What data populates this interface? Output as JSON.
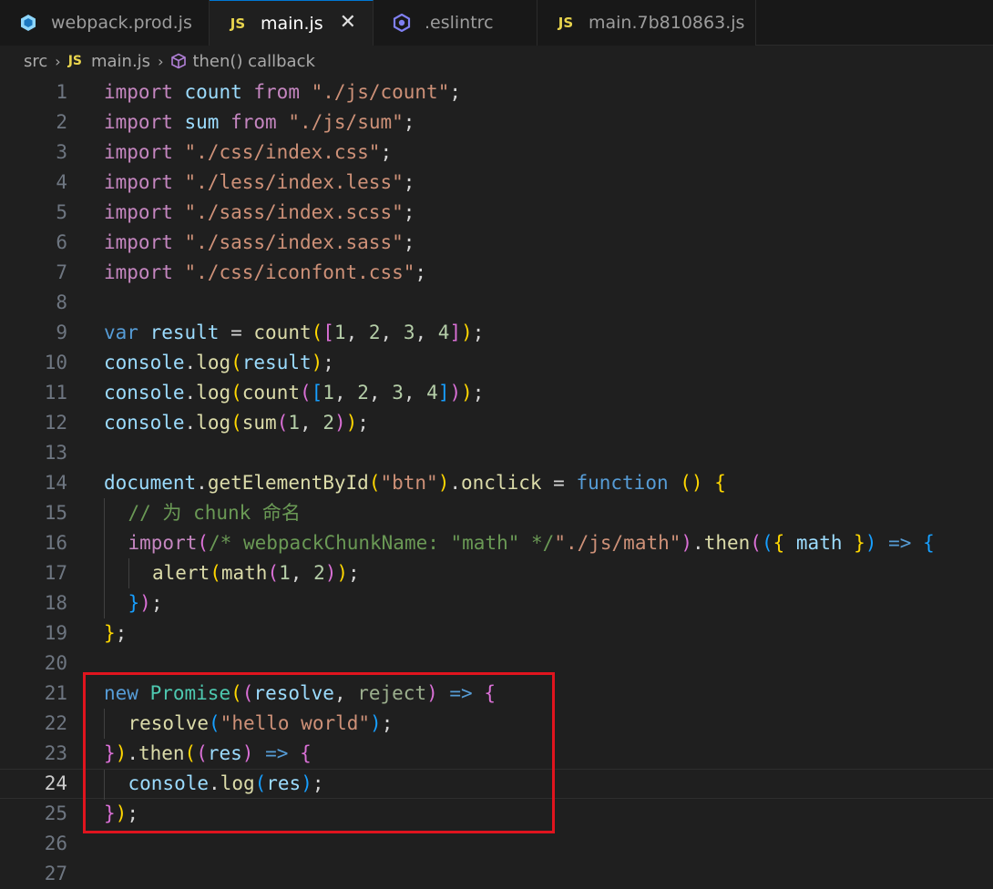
{
  "tabs": [
    {
      "label": "webpack.prod.js",
      "icon": "webpack-file-icon",
      "active": false
    },
    {
      "label": "main.js",
      "icon": "js-file-icon",
      "badge": "JS",
      "active": true
    },
    {
      "label": ".eslintrc",
      "icon": "eslint-file-icon",
      "active": false
    },
    {
      "label": "main.7b810863.js",
      "icon": "js-file-icon",
      "badge": "JS",
      "active": false
    }
  ],
  "breadcrumb": {
    "folder": "src",
    "file_badge": "JS",
    "file": "main.js",
    "symbol": "then() callback"
  },
  "editor": {
    "current_line": 24,
    "lines": [
      {
        "n": "1",
        "tokens": [
          [
            "k",
            "import"
          ],
          [
            "p",
            " "
          ],
          [
            "v",
            "count"
          ],
          [
            "p",
            " "
          ],
          [
            "k",
            "from"
          ],
          [
            "p",
            " "
          ],
          [
            "s",
            "\"./js/count\""
          ],
          [
            "p",
            ";"
          ]
        ]
      },
      {
        "n": "2",
        "tokens": [
          [
            "k",
            "import"
          ],
          [
            "p",
            " "
          ],
          [
            "v",
            "sum"
          ],
          [
            "p",
            " "
          ],
          [
            "k",
            "from"
          ],
          [
            "p",
            " "
          ],
          [
            "s",
            "\"./js/sum\""
          ],
          [
            "p",
            ";"
          ]
        ]
      },
      {
        "n": "3",
        "tokens": [
          [
            "k",
            "import"
          ],
          [
            "p",
            " "
          ],
          [
            "s",
            "\"./css/index.css\""
          ],
          [
            "p",
            ";"
          ]
        ]
      },
      {
        "n": "4",
        "tokens": [
          [
            "k",
            "import"
          ],
          [
            "p",
            " "
          ],
          [
            "s",
            "\"./less/index.less\""
          ],
          [
            "p",
            ";"
          ]
        ]
      },
      {
        "n": "5",
        "tokens": [
          [
            "k",
            "import"
          ],
          [
            "p",
            " "
          ],
          [
            "s",
            "\"./sass/index.scss\""
          ],
          [
            "p",
            ";"
          ]
        ]
      },
      {
        "n": "6",
        "tokens": [
          [
            "k",
            "import"
          ],
          [
            "p",
            " "
          ],
          [
            "s",
            "\"./sass/index.sass\""
          ],
          [
            "p",
            ";"
          ]
        ]
      },
      {
        "n": "7",
        "tokens": [
          [
            "k",
            "import"
          ],
          [
            "p",
            " "
          ],
          [
            "s",
            "\"./css/iconfont.css\""
          ],
          [
            "p",
            ";"
          ]
        ]
      },
      {
        "n": "8",
        "tokens": []
      },
      {
        "n": "9",
        "tokens": [
          [
            "b",
            "var"
          ],
          [
            "p",
            " "
          ],
          [
            "v",
            "result"
          ],
          [
            "p",
            " = "
          ],
          [
            "f",
            "count"
          ],
          [
            "y",
            "("
          ],
          [
            "m",
            "["
          ],
          [
            "n",
            "1"
          ],
          [
            "p",
            ", "
          ],
          [
            "n",
            "2"
          ],
          [
            "p",
            ", "
          ],
          [
            "n",
            "3"
          ],
          [
            "p",
            ", "
          ],
          [
            "n",
            "4"
          ],
          [
            "m",
            "]"
          ],
          [
            "y",
            ")"
          ],
          [
            "p",
            ";"
          ]
        ]
      },
      {
        "n": "10",
        "tokens": [
          [
            "v",
            "console"
          ],
          [
            "p",
            "."
          ],
          [
            "f",
            "log"
          ],
          [
            "y",
            "("
          ],
          [
            "v",
            "result"
          ],
          [
            "y",
            ")"
          ],
          [
            "p",
            ";"
          ]
        ]
      },
      {
        "n": "11",
        "tokens": [
          [
            "v",
            "console"
          ],
          [
            "p",
            "."
          ],
          [
            "f",
            "log"
          ],
          [
            "y",
            "("
          ],
          [
            "f",
            "count"
          ],
          [
            "m",
            "("
          ],
          [
            "bl",
            "["
          ],
          [
            "n",
            "1"
          ],
          [
            "p",
            ", "
          ],
          [
            "n",
            "2"
          ],
          [
            "p",
            ", "
          ],
          [
            "n",
            "3"
          ],
          [
            "p",
            ", "
          ],
          [
            "n",
            "4"
          ],
          [
            "bl",
            "]"
          ],
          [
            "m",
            ")"
          ],
          [
            "y",
            ")"
          ],
          [
            "p",
            ";"
          ]
        ]
      },
      {
        "n": "12",
        "tokens": [
          [
            "v",
            "console"
          ],
          [
            "p",
            "."
          ],
          [
            "f",
            "log"
          ],
          [
            "y",
            "("
          ],
          [
            "f",
            "sum"
          ],
          [
            "m",
            "("
          ],
          [
            "n",
            "1"
          ],
          [
            "p",
            ", "
          ],
          [
            "n",
            "2"
          ],
          [
            "m",
            ")"
          ],
          [
            "y",
            ")"
          ],
          [
            "p",
            ";"
          ]
        ]
      },
      {
        "n": "13",
        "tokens": []
      },
      {
        "n": "14",
        "tokens": [
          [
            "v",
            "document"
          ],
          [
            "p",
            "."
          ],
          [
            "f",
            "getElementById"
          ],
          [
            "y",
            "("
          ],
          [
            "s",
            "\"btn\""
          ],
          [
            "y",
            ")"
          ],
          [
            "p",
            "."
          ],
          [
            "f",
            "onclick"
          ],
          [
            "p",
            " = "
          ],
          [
            "b",
            "function"
          ],
          [
            "p",
            " "
          ],
          [
            "y",
            "()"
          ],
          [
            "p",
            " "
          ],
          [
            "y",
            "{"
          ]
        ]
      },
      {
        "n": "15",
        "indent": 1,
        "tokens": [
          [
            "c",
            "// 为 chunk 命名"
          ]
        ]
      },
      {
        "n": "16",
        "indent": 1,
        "tokens": [
          [
            "k",
            "import"
          ],
          [
            "m",
            "("
          ],
          [
            "c",
            "/* webpackChunkName: \"math\" */"
          ],
          [
            "s",
            "\"./js/math\""
          ],
          [
            "m",
            ")"
          ],
          [
            "p",
            "."
          ],
          [
            "f",
            "then"
          ],
          [
            "m",
            "("
          ],
          [
            "bl",
            "("
          ],
          [
            "y",
            "{"
          ],
          [
            "p",
            " "
          ],
          [
            "v",
            "math"
          ],
          [
            "p",
            " "
          ],
          [
            "y",
            "}"
          ],
          [
            "bl",
            ")"
          ],
          [
            "p",
            " "
          ],
          [
            "b",
            "=>"
          ],
          [
            "p",
            " "
          ],
          [
            "bl",
            "{"
          ]
        ]
      },
      {
        "n": "17",
        "indent": 2,
        "tokens": [
          [
            "f",
            "alert"
          ],
          [
            "y",
            "("
          ],
          [
            "f",
            "math"
          ],
          [
            "m",
            "("
          ],
          [
            "n",
            "1"
          ],
          [
            "p",
            ", "
          ],
          [
            "n",
            "2"
          ],
          [
            "m",
            ")"
          ],
          [
            "y",
            ")"
          ],
          [
            "p",
            ";"
          ]
        ]
      },
      {
        "n": "18",
        "indent": 1,
        "tokens": [
          [
            "bl",
            "}"
          ],
          [
            "m",
            ")"
          ],
          [
            "p",
            ";"
          ]
        ]
      },
      {
        "n": "19",
        "tokens": [
          [
            "y",
            "}"
          ],
          [
            "p",
            ";"
          ]
        ]
      },
      {
        "n": "20",
        "tokens": []
      },
      {
        "n": "21",
        "tokens": [
          [
            "b",
            "new"
          ],
          [
            "p",
            " "
          ],
          [
            "t",
            "Promise"
          ],
          [
            "y",
            "("
          ],
          [
            "m",
            "("
          ],
          [
            "v",
            "resolve"
          ],
          [
            "p",
            ", "
          ],
          [
            "gr",
            "reject"
          ],
          [
            "m",
            ")"
          ],
          [
            "p",
            " "
          ],
          [
            "b",
            "=>"
          ],
          [
            "p",
            " "
          ],
          [
            "m",
            "{"
          ]
        ]
      },
      {
        "n": "22",
        "indent": 1,
        "tokens": [
          [
            "f",
            "resolve"
          ],
          [
            "bl",
            "("
          ],
          [
            "s",
            "\"hello world\""
          ],
          [
            "bl",
            ")"
          ],
          [
            "p",
            ";"
          ]
        ]
      },
      {
        "n": "23",
        "tokens": [
          [
            "m",
            "}"
          ],
          [
            "y",
            ")"
          ],
          [
            "p",
            "."
          ],
          [
            "f",
            "then"
          ],
          [
            "y",
            "("
          ],
          [
            "m",
            "("
          ],
          [
            "v",
            "res"
          ],
          [
            "m",
            ")"
          ],
          [
            "p",
            " "
          ],
          [
            "b",
            "=>"
          ],
          [
            "p",
            " "
          ],
          [
            "m",
            "{"
          ]
        ]
      },
      {
        "n": "24",
        "indent": 1,
        "tokens": [
          [
            "v",
            "console"
          ],
          [
            "p",
            "."
          ],
          [
            "f",
            "log"
          ],
          [
            "bl",
            "("
          ],
          [
            "v",
            "res"
          ],
          [
            "bl",
            ")"
          ],
          [
            "p",
            ";"
          ]
        ]
      },
      {
        "n": "25",
        "tokens": [
          [
            "m",
            "}"
          ],
          [
            "y",
            ")"
          ],
          [
            "p",
            ";"
          ]
        ]
      },
      {
        "n": "26",
        "tokens": []
      },
      {
        "n": "27",
        "tokens": []
      }
    ]
  },
  "annotation": {
    "color": "#e0141e",
    "lines": [
      21,
      25
    ]
  }
}
